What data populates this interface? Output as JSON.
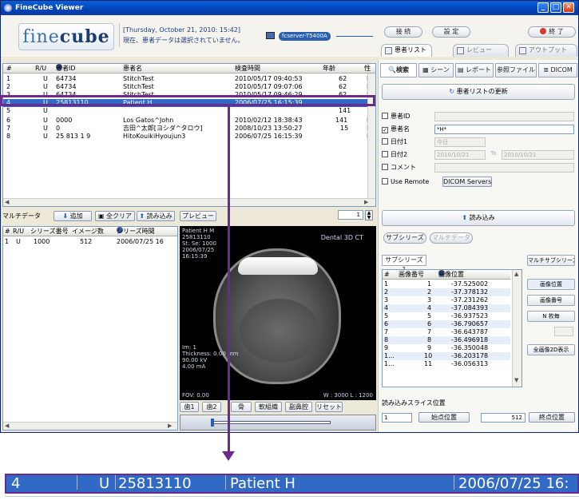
{
  "window": {
    "title": "FineCube Viewer"
  },
  "header": {
    "logo": {
      "left": "fine",
      "right": "cube"
    },
    "status_line1": "[Thursday, October 21, 2010: 15:42]",
    "status_line2": "現在、患者データは選択されていません。",
    "server": "fcserver-T5400A",
    "connect": "接 続",
    "settings": "設 定",
    "exit": "終 了"
  },
  "top_tabs": [
    "患者リスト",
    "シーン",
    "レビュー",
    "アウトプット"
  ],
  "patient_list": {
    "columns": [
      "#",
      "R/U",
      "患者ID",
      "患者名",
      "検査時間",
      "年齢",
      "性"
    ],
    "rows": [
      [
        "1",
        "U",
        "64734",
        "StitchTest",
        "2010/05/17 09:40:53",
        "62",
        "F"
      ],
      [
        "2",
        "U",
        "64734",
        "StitchTest",
        "2010/05/17 09:07:06",
        "62",
        "F"
      ],
      [
        "3",
        "U",
        "64734",
        "StitchTest",
        "2010/05/17 09:46:29",
        "62",
        "F"
      ],
      [
        "4",
        "U",
        "25813110",
        "Patient H",
        "2006/07/25 16:15:39",
        "",
        ""
      ],
      [
        "5",
        "U",
        "",
        "",
        "",
        "141",
        ""
      ],
      [
        "6",
        "U",
        "0000",
        "Los Gatos^John",
        "2010/02/12 18:38:43",
        "141",
        "M"
      ],
      [
        "7",
        "U",
        "0",
        "吉田^太郎[ヨシダ^タロウ]",
        "2008/10/23 13:50:27",
        "15",
        "M"
      ],
      [
        "8",
        "U",
        "25 813 1 9",
        "HitoKouikiHyoujun3",
        "2006/07/25 16:15:39",
        "",
        "M"
      ]
    ]
  },
  "multi_bar": {
    "label": "マルチデータ",
    "add": "追加",
    "clear_all": "全クリア",
    "load": "読み込み",
    "preview": "プレビュー",
    "page": "1"
  },
  "series_list": {
    "columns": [
      "#",
      "R/U",
      "シリーズ番号",
      "イメージ数",
      "シリーズ時間"
    ],
    "rows": [
      [
        "1",
        "U",
        "1000",
        "512",
        "2006/07/25 16"
      ]
    ]
  },
  "viewer": {
    "info": [
      "Patient H M",
      "25813110",
      "St: Se: 1000",
      "2006/07/25",
      "16:15:39"
    ],
    "label": "Dental 3D CT",
    "params": [
      "Im: 1",
      "Thickness: 0.00 mm",
      "90.00 kV",
      "4.00 mA"
    ],
    "fov": "FOV: 0.00",
    "wl": "W : 3000 L : 1200",
    "buttons": [
      "歯1",
      "歯2",
      "骨",
      "軟組織",
      "副鼻腔",
      "リセット"
    ]
  },
  "right_panel": {
    "tabs": [
      "検索",
      "シーン",
      "レポート",
      "参照ファイル",
      "DICOM"
    ],
    "refresh": "患者リストの更新",
    "filters": [
      {
        "label": "患者ID",
        "checked": false,
        "value": ""
      },
      {
        "label": "患者名",
        "checked": true,
        "value": "*H*"
      },
      {
        "label": "日付1",
        "checked": false,
        "value": "今日"
      },
      {
        "label": "日付2",
        "checked": false,
        "value": "2010/10/21"
      },
      {
        "label": "コメント",
        "checked": false,
        "value": ""
      },
      {
        "label": "Use Remote",
        "checked": false,
        "value": ""
      }
    ],
    "date2_to_label": "To",
    "date2_to": "2010/10/21",
    "dicom_servers": "DICOM Servers",
    "load": "読み込み",
    "sub_tabs": [
      "サブシリーズ",
      "マルチデータ"
    ],
    "subseries_tab": "サブシリーズ 1",
    "multi_subseries": "マルチサブシリーズ",
    "image_table": {
      "columns": [
        "#",
        "画像番号",
        "画像位置"
      ],
      "rows": [
        [
          "1",
          "1",
          "-37.525002"
        ],
        [
          "2",
          "2",
          "-37.378132"
        ],
        [
          "3",
          "3",
          "-37.231262"
        ],
        [
          "4",
          "4",
          "-37.084393"
        ],
        [
          "5",
          "5",
          "-36.937523"
        ],
        [
          "6",
          "6",
          "-36.790657"
        ],
        [
          "7",
          "7",
          "-36.643787"
        ],
        [
          "8",
          "8",
          "-36.496918"
        ],
        [
          "9",
          "9",
          "-36.350048"
        ],
        [
          "1...",
          "10",
          "-36.203178"
        ],
        [
          "1...",
          "11",
          "-36.056313"
        ]
      ]
    },
    "side_buttons": [
      "画像位置",
      "画像番号",
      "N 枚毎",
      "全画像2D表示"
    ],
    "slice_label": "読み込みスライス位置",
    "slice_start": "1",
    "start_button": "始点位置",
    "slice_end": "512",
    "end_button": "終点位置"
  },
  "zoom": {
    "cells": [
      "4",
      "U",
      "25813110",
      "Patient H",
      "2006/07/25 16:"
    ]
  },
  "colors": {
    "selection": "#316ac5",
    "callout": "#6e2a8a",
    "titlebar": "#0343b9"
  }
}
